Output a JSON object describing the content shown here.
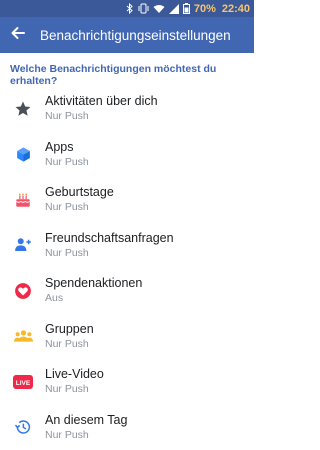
{
  "status_bar": {
    "battery_percent": "70%",
    "time": "22:40"
  },
  "header": {
    "title": "Benachrichtigungseinstellungen"
  },
  "prompt": "Welche Benachrichtigungen möchtest du erhalten?",
  "items": [
    {
      "label": "Aktivitäten über dich",
      "status": "Nur Push",
      "icon": "star-icon"
    },
    {
      "label": "Apps",
      "status": "Nur Push",
      "icon": "cube-icon"
    },
    {
      "label": "Geburtstage",
      "status": "Nur Push",
      "icon": "cake-icon"
    },
    {
      "label": "Freundschaftsanfragen",
      "status": "Nur Push",
      "icon": "add-friend-icon"
    },
    {
      "label": "Spendenaktionen",
      "status": "Aus",
      "icon": "heart-badge-icon"
    },
    {
      "label": "Gruppen",
      "status": "Nur Push",
      "icon": "groups-icon"
    },
    {
      "label": "Live-Video",
      "status": "Nur Push",
      "icon": "live-video-icon",
      "icon_text": "LIVE"
    },
    {
      "label": "An diesem Tag",
      "status": "Nur Push",
      "icon": "history-clock-icon"
    }
  ],
  "colors": {
    "header_bg": "#4267b2",
    "status_bg": "#3b5998",
    "accent": "#4267b2",
    "text_primary": "#1c1e21",
    "text_secondary": "#8d949e"
  }
}
